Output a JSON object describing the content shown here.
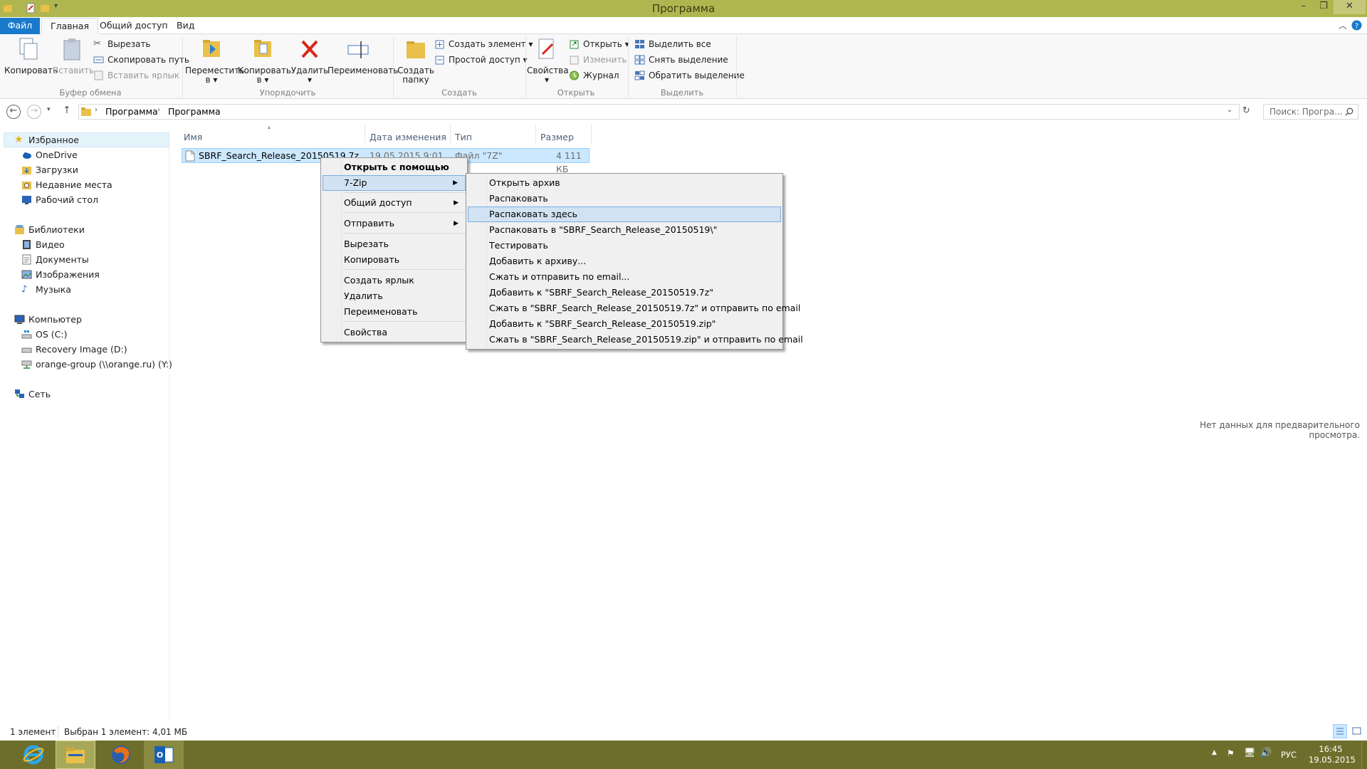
{
  "window": {
    "title": "Программа"
  },
  "ribbon_tabs": [
    "Файл",
    "Главная",
    "Общий доступ",
    "Вид"
  ],
  "ribbon": {
    "clipboard": {
      "group_label": "Буфер обмена",
      "copy": "Копировать",
      "paste": "Вставить",
      "cut": "Вырезать",
      "copy_path": "Скопировать путь",
      "paste_shortcut": "Вставить ярлык"
    },
    "organize": {
      "group_label": "Упорядочить",
      "move_to_1": "Переместить",
      "move_to_2": "в",
      "copy_to_1": "Копировать",
      "copy_to_2": "в",
      "delete": "Удалить",
      "rename": "Переименовать"
    },
    "create": {
      "group_label": "Создать",
      "new_folder_1": "Создать",
      "new_folder_2": "папку",
      "new_item": "Создать элемент",
      "easy_access": "Простой доступ"
    },
    "open": {
      "group_label": "Открыть",
      "properties": "Свойства",
      "open": "Открыть",
      "edit": "Изменить",
      "history": "Журнал"
    },
    "select": {
      "group_label": "Выделить",
      "select_all": "Выделить все",
      "select_none": "Снять выделение",
      "invert": "Обратить выделение"
    }
  },
  "address": {
    "crumbs": [
      "Программа",
      "Программа"
    ],
    "search_placeholder": "Поиск: Програ..."
  },
  "nav": {
    "favorites": "Избранное",
    "favorites_items": [
      "OneDrive",
      "Загрузки",
      "Недавние места",
      "Рабочий стол"
    ],
    "libraries": "Библиотеки",
    "libraries_items": [
      "Видео",
      "Документы",
      "Изображения",
      "Музыка"
    ],
    "computer": "Компьютер",
    "computer_items": [
      "OS (C:)",
      "Recovery Image (D:)",
      "orange-group (\\\\orange.ru) (Y:)"
    ],
    "network": "Сеть"
  },
  "columns": {
    "name": "Имя",
    "date": "Дата изменения",
    "type": "Тип",
    "size": "Размер"
  },
  "file": {
    "name": "SBRF_Search_Release_20150519.7z",
    "date": "19.05.2015 9:01",
    "type": "Файл \"7Z\"",
    "size": "4 111 КБ"
  },
  "context_menu": {
    "items": [
      "Открыть с помощью",
      "7-Zip",
      "Общий доступ",
      "Отправить",
      "Вырезать",
      "Копировать",
      "Создать ярлык",
      "Удалить",
      "Переименовать",
      "Свойства"
    ]
  },
  "submenu_7zip": {
    "items": [
      "Открыть архив",
      "Распаковать",
      "Распаковать здесь",
      "Распаковать в \"SBRF_Search_Release_20150519\\\"",
      "Тестировать",
      "Добавить к архиву...",
      "Сжать и отправить по email...",
      "Добавить к \"SBRF_Search_Release_20150519.7z\"",
      "Сжать в \"SBRF_Search_Release_20150519.7z\" и отправить по email",
      "Добавить к \"SBRF_Search_Release_20150519.zip\"",
      "Сжать в \"SBRF_Search_Release_20150519.zip\" и отправить по email"
    ],
    "highlighted": "Распаковать здесь"
  },
  "preview_text": "Нет данных для предварительного просмотра.",
  "status": {
    "count": "1 элемент",
    "selection": "Выбран 1 элемент: 4,01 МБ"
  },
  "taskbar": {
    "language": "РУС",
    "time": "16:45",
    "date": "19.05.2015"
  },
  "colors": {
    "titlebar": "#b0b64f",
    "file_tab": "#1979ca",
    "selection": "#cce8ff",
    "menu_highlight": "#d1e2f2",
    "taskbar": "#6e6e2c"
  }
}
